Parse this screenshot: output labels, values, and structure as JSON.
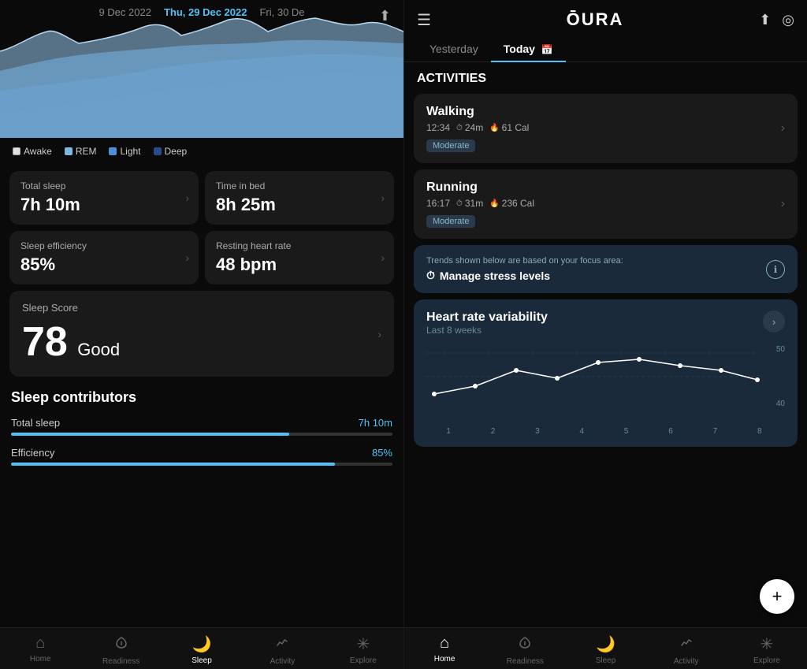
{
  "left": {
    "dates": {
      "prev": "9 Dec 2022",
      "current": "Thu, 29 Dec 2022",
      "next": "Fri, 30 De"
    },
    "legend": [
      {
        "label": "Awake",
        "color": "#f0f0f0"
      },
      {
        "label": "REM",
        "color": "#7ab8e0"
      },
      {
        "label": "Light",
        "color": "#4a90d9"
      },
      {
        "label": "Deep",
        "color": "#2a4a8a"
      }
    ],
    "metrics": [
      {
        "label": "Total sleep",
        "value": "7h 10m"
      },
      {
        "label": "Time in bed",
        "value": "8h 25m"
      },
      {
        "label": "Sleep efficiency",
        "value": "85%"
      },
      {
        "label": "Resting heart rate",
        "value": "48 bpm"
      }
    ],
    "score": {
      "label": "Sleep Score",
      "value": "78",
      "quality": "Good"
    },
    "contributors_title": "Sleep contributors",
    "contributors": [
      {
        "name": "Total sleep",
        "value": "7h 10m",
        "pct": 73
      },
      {
        "name": "Efficiency",
        "value": "85%",
        "pct": 85
      }
    ],
    "nav": [
      {
        "label": "Home",
        "icon": "⌂",
        "active": false
      },
      {
        "label": "Readiness",
        "icon": "♡",
        "active": false
      },
      {
        "label": "Sleep",
        "icon": "🌙",
        "active": true
      },
      {
        "label": "Activity",
        "icon": "🔥",
        "active": false
      },
      {
        "label": "Explore",
        "icon": "✳",
        "active": false
      }
    ]
  },
  "right": {
    "header": {
      "logo": "ŌURA"
    },
    "tabs": [
      {
        "label": "Yesterday",
        "active": false
      },
      {
        "label": "Today",
        "active": true,
        "has_cal": true
      }
    ],
    "activities_title": "ACTIVITIES",
    "activities": [
      {
        "name": "Walking",
        "time": "12:34",
        "duration": "24m",
        "calories": "61 Cal",
        "intensity": "Moderate"
      },
      {
        "name": "Running",
        "time": "16:17",
        "duration": "31m",
        "calories": "236 Cal",
        "intensity": "Moderate"
      }
    ],
    "focus": {
      "label": "Trends shown below are based on your focus area:",
      "value": "Manage stress levels"
    },
    "hrv": {
      "title": "Heart rate variability",
      "subtitle": "Last 8 weeks",
      "y_labels": [
        "50",
        "40"
      ],
      "x_labels": [
        "1",
        "2",
        "3",
        "4",
        "5",
        "6",
        "7",
        "8"
      ],
      "points": [
        {
          "x": 0,
          "y": 62
        },
        {
          "x": 1,
          "y": 58
        },
        {
          "x": 2,
          "y": 40
        },
        {
          "x": 3,
          "y": 48
        },
        {
          "x": 4,
          "y": 30
        },
        {
          "x": 5,
          "y": 28
        },
        {
          "x": 6,
          "y": 30
        },
        {
          "x": 7,
          "y": 35
        },
        {
          "x": 8,
          "y": 50
        }
      ]
    },
    "nav": [
      {
        "label": "Home",
        "icon": "⌂",
        "active": true
      },
      {
        "label": "Readiness",
        "icon": "♡",
        "active": false
      },
      {
        "label": "Sleep",
        "icon": "🌙",
        "active": false
      },
      {
        "label": "Activity",
        "icon": "🔥",
        "active": false
      },
      {
        "label": "Explore",
        "icon": "✳",
        "active": false
      }
    ],
    "fab_label": "+"
  }
}
